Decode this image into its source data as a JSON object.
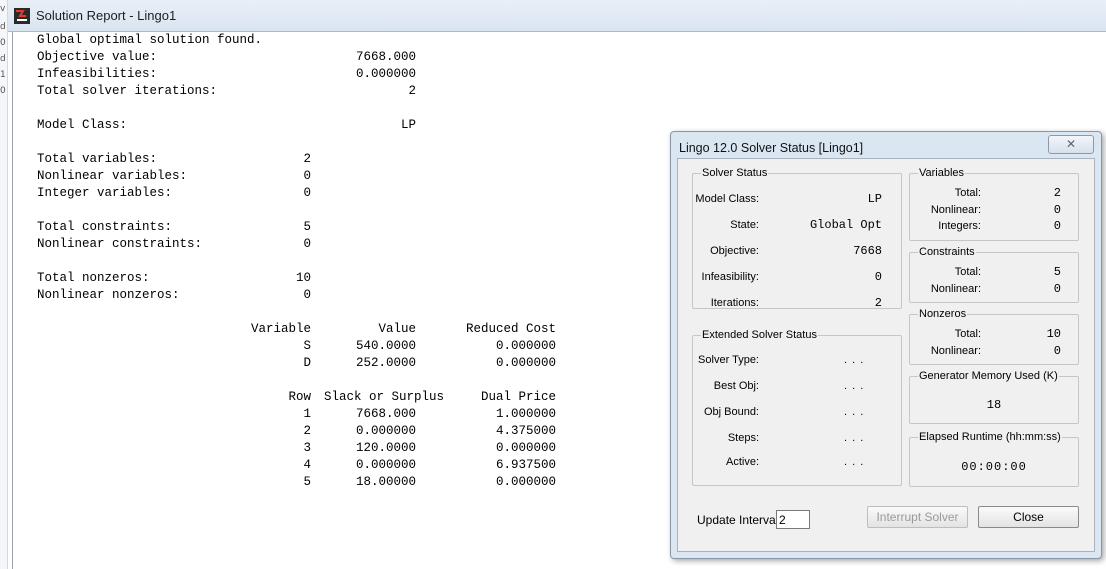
{
  "report": {
    "title": "Solution Report - Lingo1",
    "lines": {
      "status": "Global optimal solution found.",
      "objective_label": "Objective value:",
      "objective_value": "7668.000",
      "infeas_label": "Infeasibilities:",
      "infeas_value": "0.000000",
      "iter_label": "Total solver iterations:",
      "iter_value": "2",
      "model_class_label": "Model Class:",
      "model_class_value": "LP",
      "total_vars_label": "Total variables:",
      "total_vars_value": "2",
      "nonlin_vars_label": "Nonlinear variables:",
      "nonlin_vars_value": "0",
      "int_vars_label": "Integer variables:",
      "int_vars_value": "0",
      "total_cons_label": "Total constraints:",
      "total_cons_value": "5",
      "nonlin_cons_label": "Nonlinear constraints:",
      "nonlin_cons_value": "0",
      "total_nz_label": "Total nonzeros:",
      "total_nz_value": "10",
      "nonlin_nz_label": "Nonlinear nonzeros:",
      "nonlin_nz_value": "0"
    },
    "variables_table": {
      "headers": [
        "Variable",
        "Value",
        "Reduced Cost"
      ],
      "rows": [
        [
          "S",
          "540.0000",
          "0.000000"
        ],
        [
          "D",
          "252.0000",
          "0.000000"
        ]
      ]
    },
    "rows_table": {
      "headers": [
        "Row",
        "Slack or Surplus",
        "Dual Price"
      ],
      "rows": [
        [
          "1",
          "7668.000",
          "1.000000"
        ],
        [
          "2",
          "0.000000",
          "4.375000"
        ],
        [
          "3",
          "120.0000",
          "0.000000"
        ],
        [
          "4",
          "0.000000",
          "6.937500"
        ],
        [
          "5",
          "18.00000",
          "0.000000"
        ]
      ]
    }
  },
  "edge_strip": [
    "v",
    "d",
    "0",
    "d",
    "1",
    "0"
  ],
  "dialog": {
    "title": "Lingo 12.0 Solver Status [Lingo1]",
    "close_glyph": "✕",
    "solver_status": {
      "legend": "Solver Status",
      "model_class_label": "Model Class:",
      "model_class_value": "LP",
      "state_label": "State:",
      "state_value": "Global Opt",
      "objective_label": "Objective:",
      "objective_value": "7668",
      "infeasibility_label": "Infeasibility:",
      "infeasibility_value": "0",
      "iterations_label": "Iterations:",
      "iterations_value": "2"
    },
    "extended_status": {
      "legend": "Extended Solver Status",
      "solver_type_label": "Solver Type:",
      "best_obj_label": "Best Obj:",
      "obj_bound_label": "Obj Bound:",
      "steps_label": "Steps:",
      "active_label": "Active:",
      "dots": ". . ."
    },
    "variables": {
      "legend": "Variables",
      "total_label": "Total:",
      "total_value": "2",
      "nonlinear_label": "Nonlinear:",
      "nonlinear_value": "0",
      "integers_label": "Integers:",
      "integers_value": "0"
    },
    "constraints": {
      "legend": "Constraints",
      "total_label": "Total:",
      "total_value": "5",
      "nonlinear_label": "Nonlinear:",
      "nonlinear_value": "0"
    },
    "nonzeros": {
      "legend": "Nonzeros",
      "total_label": "Total:",
      "total_value": "10",
      "nonlinear_label": "Nonlinear:",
      "nonlinear_value": "0"
    },
    "generator_memory": {
      "legend": "Generator Memory Used (K)",
      "value": "18"
    },
    "elapsed_runtime": {
      "legend": "Elapsed Runtime (hh:mm:ss)",
      "value": "00:00:00"
    },
    "update_interval_label": "Update Interval:",
    "update_interval_value": "2",
    "interrupt_button": "Interrupt Solver",
    "close_button": "Close"
  }
}
